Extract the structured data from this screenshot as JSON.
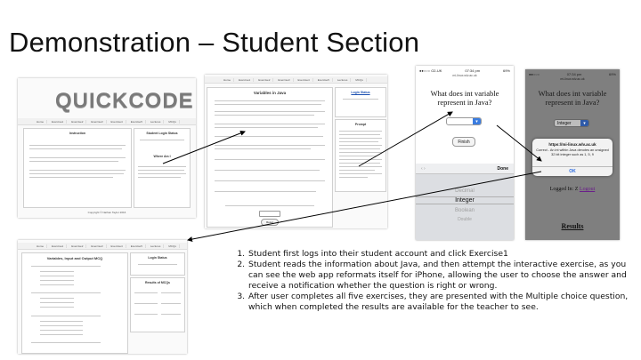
{
  "slide": {
    "title": "Demonstration – Student Section"
  },
  "screens": {
    "home": {
      "logo": "QUICKCODE",
      "nav": [
        "Home",
        "Exercise1",
        "Exercise2",
        "Exercise3",
        "Exercise4",
        "Exercise5",
        "Lectures",
        "MCQs"
      ],
      "left_panel_title": "Instruction",
      "right_panel_title": "Student Login Status",
      "right_panel_subtitle": "Where Am I",
      "footer": "Copyright © Nathan Taylor 2016"
    },
    "variables": {
      "title": "Variables in Java",
      "side_title": "Login Status",
      "side2_title": "Prompt",
      "submit": "Reset"
    },
    "mcq": {
      "title": "Variables, Input and Output MCQ",
      "side_title": "Login Status",
      "side2_title": "Results of MCQs"
    },
    "phone1": {
      "carrier": "●●○○○ O2-UK",
      "time": "07:34 pm",
      "battery": "69%",
      "url": "mi-linux.wlv.ac.uk",
      "question": "What does int variable represent in Java?",
      "select_value": "",
      "finish": "Finish",
      "done": "Done",
      "options": [
        "Decimal",
        "Integer",
        "Boolean",
        "Double"
      ],
      "selected_option": "Integer"
    },
    "phone2": {
      "time": "07:34 pm",
      "battery": "69%",
      "url": "mi-linux.wlv.ac.uk",
      "question": "What does int variable represent in Java?",
      "select_value": "Integer",
      "alert_url": "https://mi-linux.wlv.ac.uk",
      "alert_message": "Correct - An int within Java denotes an unsigned 32 bit integer such as 1, 5, 9",
      "alert_ok": "OK",
      "logged_in_label": "Logged In: Z",
      "logout_label": "Logout",
      "results_link": "Results"
    }
  },
  "steps": [
    "Student first logs into their student account and click Exercise1",
    "Student reads the information about Java, and then attempt the interactive exercise, as you can see the web app reformats itself for iPhone, allowing the user to choose the answer and receive a notification whether the question is right or wrong.",
    "After user completes all five exercises, they are presented with the Multiple choice question, which when completed the results are available for the teacher to see."
  ]
}
